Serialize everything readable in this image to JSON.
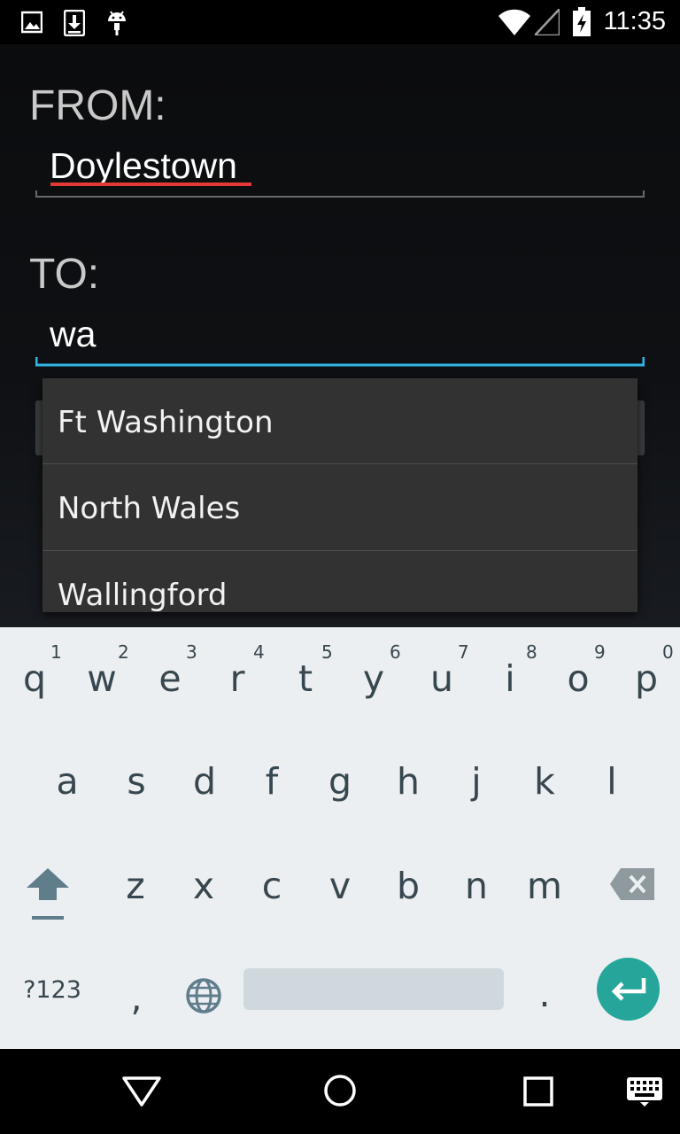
{
  "status_bar": {
    "time": "11:35",
    "left_icons": [
      "image-icon",
      "download-icon",
      "android-icon"
    ],
    "right_icons": [
      "wifi-icon",
      "cell-signal-icon",
      "battery-charging-icon"
    ]
  },
  "form": {
    "from_label": "FROM:",
    "from_value": "Doylestown",
    "to_label": "TO:",
    "to_value": "wa"
  },
  "suggestions": [
    "Ft Washington",
    "North Wales",
    "Wallingford"
  ],
  "keyboard": {
    "row1": [
      "q",
      "w",
      "e",
      "r",
      "t",
      "y",
      "u",
      "i",
      "o",
      "p"
    ],
    "row1_digits": [
      "1",
      "2",
      "3",
      "4",
      "5",
      "6",
      "7",
      "8",
      "9",
      "0"
    ],
    "row2": [
      "a",
      "s",
      "d",
      "f",
      "g",
      "h",
      "j",
      "k",
      "l"
    ],
    "row3": [
      "z",
      "x",
      "c",
      "v",
      "b",
      "n",
      "m"
    ],
    "symbols_key": "?123",
    "comma_key": ",",
    "period_key": ".",
    "accent_color": "#26a69a"
  },
  "nav_bar": {
    "icons": [
      "back-icon",
      "home-icon",
      "recents-icon",
      "keyboard-icon"
    ]
  },
  "colors": {
    "focus_underline": "#33b5e5",
    "spell_underline": "#e53935"
  }
}
